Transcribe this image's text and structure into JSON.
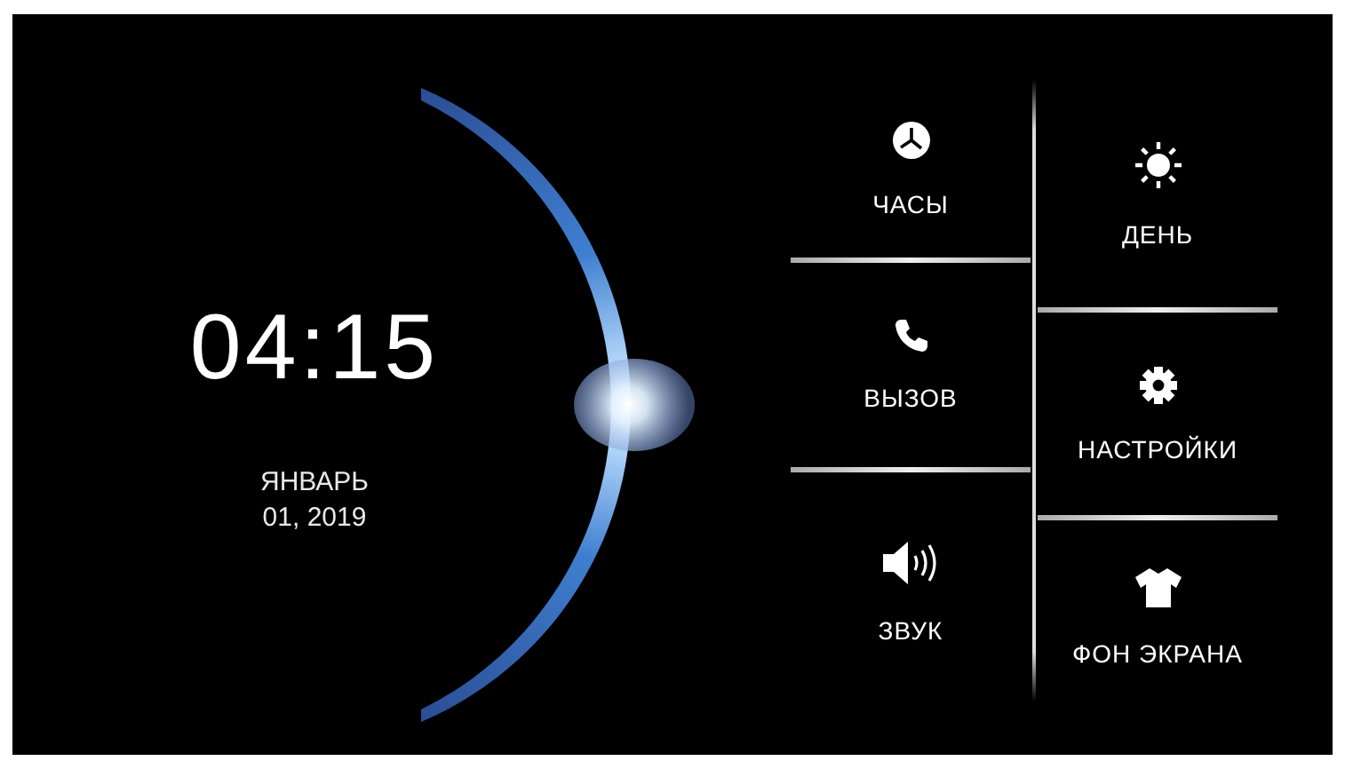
{
  "clock": {
    "time": "04:15",
    "month": "ЯНВАРЬ",
    "date": "01, 2019"
  },
  "menu": {
    "columns": [
      [
        {
          "label": "ЧАСЫ",
          "kind": "clock"
        },
        {
          "label": "ВЫЗОВ",
          "kind": "phone"
        },
        {
          "label": "ЗВУК",
          "kind": "sound"
        }
      ],
      [
        {
          "label": "ДЕНЬ",
          "kind": "sun"
        },
        {
          "label": "НАСТРОЙКИ",
          "kind": "gear"
        },
        {
          "label": "ФОН ЭКРАНА",
          "kind": "shirt"
        }
      ]
    ]
  }
}
